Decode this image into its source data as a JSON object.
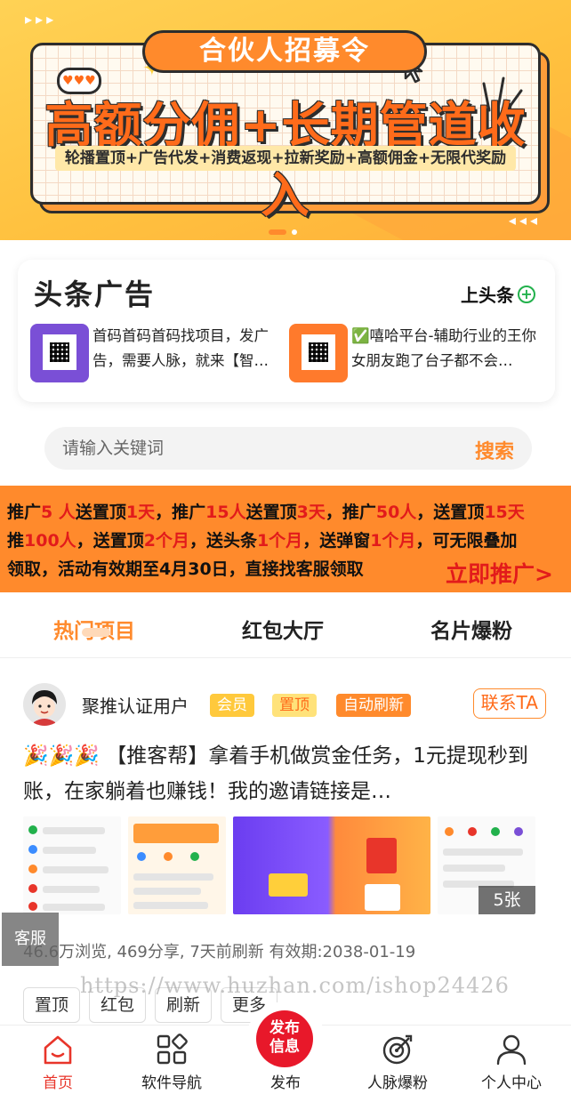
{
  "banner": {
    "tag": "合伙人招募令",
    "headline": "高额分佣+长期管道收入",
    "subline": "轮播置顶+广告代发+消费返现+拉新奖励+高额佣金+无限代奖励",
    "arrows": "▸▸▸",
    "arrows_back": "◂◂◂",
    "hearts": "♥♥♥"
  },
  "headlines": {
    "title": "头条广告",
    "action_label": "上头条",
    "items": [
      {
        "text": "首码首码首码找项目，发广告，需要人脉，就来【智…"
      },
      {
        "text": "✅嘻哈平台-辅助行业的王你女朋友跑了台子都不会…"
      }
    ]
  },
  "search": {
    "placeholder": "请输入关键词",
    "button_label": "搜索"
  },
  "promo": {
    "line1": [
      "推广",
      "5 人",
      "送置顶",
      "1天",
      "，推广",
      "15人",
      "送置顶",
      "3天",
      "，推广",
      "50人",
      "，送置顶",
      "15天"
    ],
    "line2": [
      "推",
      "100人",
      "，送置顶",
      "2个月",
      "，送头条",
      "1个月",
      "，送弹窗",
      "1个月",
      "，可无限叠加"
    ],
    "line3": "领取，活动有效期至4月30日，直接找客服领取",
    "cta": "立即推广>"
  },
  "tabs": [
    {
      "label": "热门项目",
      "active": true
    },
    {
      "label": "红包大厅",
      "active": false
    },
    {
      "label": "名片爆粉",
      "active": false
    }
  ],
  "post": {
    "username": "聚推认证用户",
    "badges": {
      "vip": "会员",
      "top": "置顶",
      "auto": "自动刷新"
    },
    "contact_label": "联系TA",
    "text": "🎉🎉🎉 【推客帮】拿着手机做赏金任务，1元提现秒到账，在家躺着也赚钱！我的邀请链接是…",
    "image_count": "5张",
    "meta": "46.6万浏览, 469分享, 7天前刷新 有效期:2038-01-19",
    "watermark": "https://www.huzhan.com/ishop24426",
    "actions": [
      "置顶",
      "红包",
      "刷新",
      "更多"
    ]
  },
  "kefu_label": "客服",
  "bottom_nav": {
    "items": [
      {
        "label": "首页",
        "icon": "home-icon",
        "active": true
      },
      {
        "label": "软件导航",
        "icon": "grid-icon",
        "active": false
      },
      {
        "label": "发布",
        "icon": "publish-icon",
        "active": false
      },
      {
        "label": "人脉爆粉",
        "icon": "target-icon",
        "active": false
      },
      {
        "label": "个人中心",
        "icon": "user-icon",
        "active": false
      }
    ],
    "publish_button": "发布信息"
  },
  "colors": {
    "accent": "#ff8a2c",
    "promo_red": "#e21b1b",
    "nav_active": "#e8352a",
    "green": "#22b14c"
  }
}
